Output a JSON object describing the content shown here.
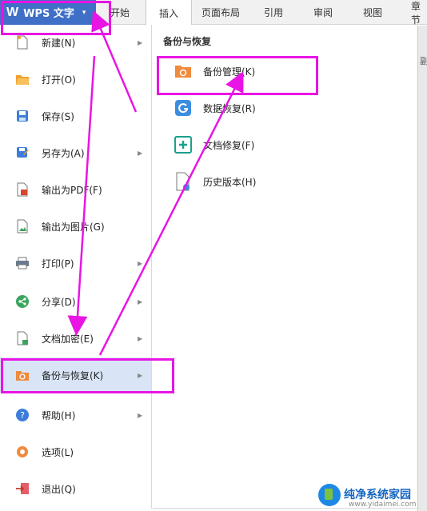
{
  "app": {
    "logo_letter": "W",
    "title": "WPS 文字",
    "caret": "▾"
  },
  "ribbon": {
    "tabs": [
      "开始",
      "插入",
      "页面布局",
      "引用",
      "审阅",
      "视图",
      "章节"
    ],
    "active_tab": "插入"
  },
  "doc_edge": {
    "text": "副"
  },
  "left_menu": {
    "items": [
      {
        "label": "新建(N)",
        "icon": "new-document-icon",
        "has_arrow": true
      },
      {
        "label": "打开(O)",
        "icon": "open-folder-icon",
        "has_arrow": false
      },
      {
        "label": "保存(S)",
        "icon": "save-icon",
        "has_arrow": false
      },
      {
        "label": "另存为(A)",
        "icon": "save-as-icon",
        "has_arrow": true
      },
      {
        "label": "输出为PDF(F)",
        "icon": "pdf-export-icon",
        "has_arrow": false
      },
      {
        "label": "输出为图片(G)",
        "icon": "image-export-icon",
        "has_arrow": false
      },
      {
        "label": "打印(P)",
        "icon": "printer-icon",
        "has_arrow": true
      },
      {
        "label": "分享(D)",
        "icon": "share-icon",
        "has_arrow": true
      },
      {
        "label": "文档加密(E)",
        "icon": "encrypt-document-icon",
        "has_arrow": true
      },
      {
        "label": "备份与恢复(K)",
        "icon": "backup-restore-icon",
        "has_arrow": true
      },
      {
        "label": "帮助(H)",
        "icon": "help-icon",
        "has_arrow": true
      },
      {
        "label": "选项(L)",
        "icon": "options-gear-icon",
        "has_arrow": false
      },
      {
        "label": "退出(Q)",
        "icon": "exit-icon",
        "has_arrow": false
      }
    ],
    "active_label": "备份与恢复(K)"
  },
  "sub_menu": {
    "title": "备份与恢复",
    "items": [
      {
        "label": "备份管理(K)",
        "icon": "backup-folder-icon"
      },
      {
        "label": "数据恢复(R)",
        "icon": "data-recovery-icon"
      },
      {
        "label": "文档修复(F)",
        "icon": "document-repair-icon"
      },
      {
        "label": "历史版本(H)",
        "icon": "history-version-icon"
      }
    ]
  },
  "colors": {
    "accent": "#3f6fc6",
    "highlight_annotation": "#e815e4",
    "active_item_bg": "#d9e5f7"
  },
  "watermark": {
    "title": "纯净系统家园",
    "url": "www.yidaimei.com"
  }
}
